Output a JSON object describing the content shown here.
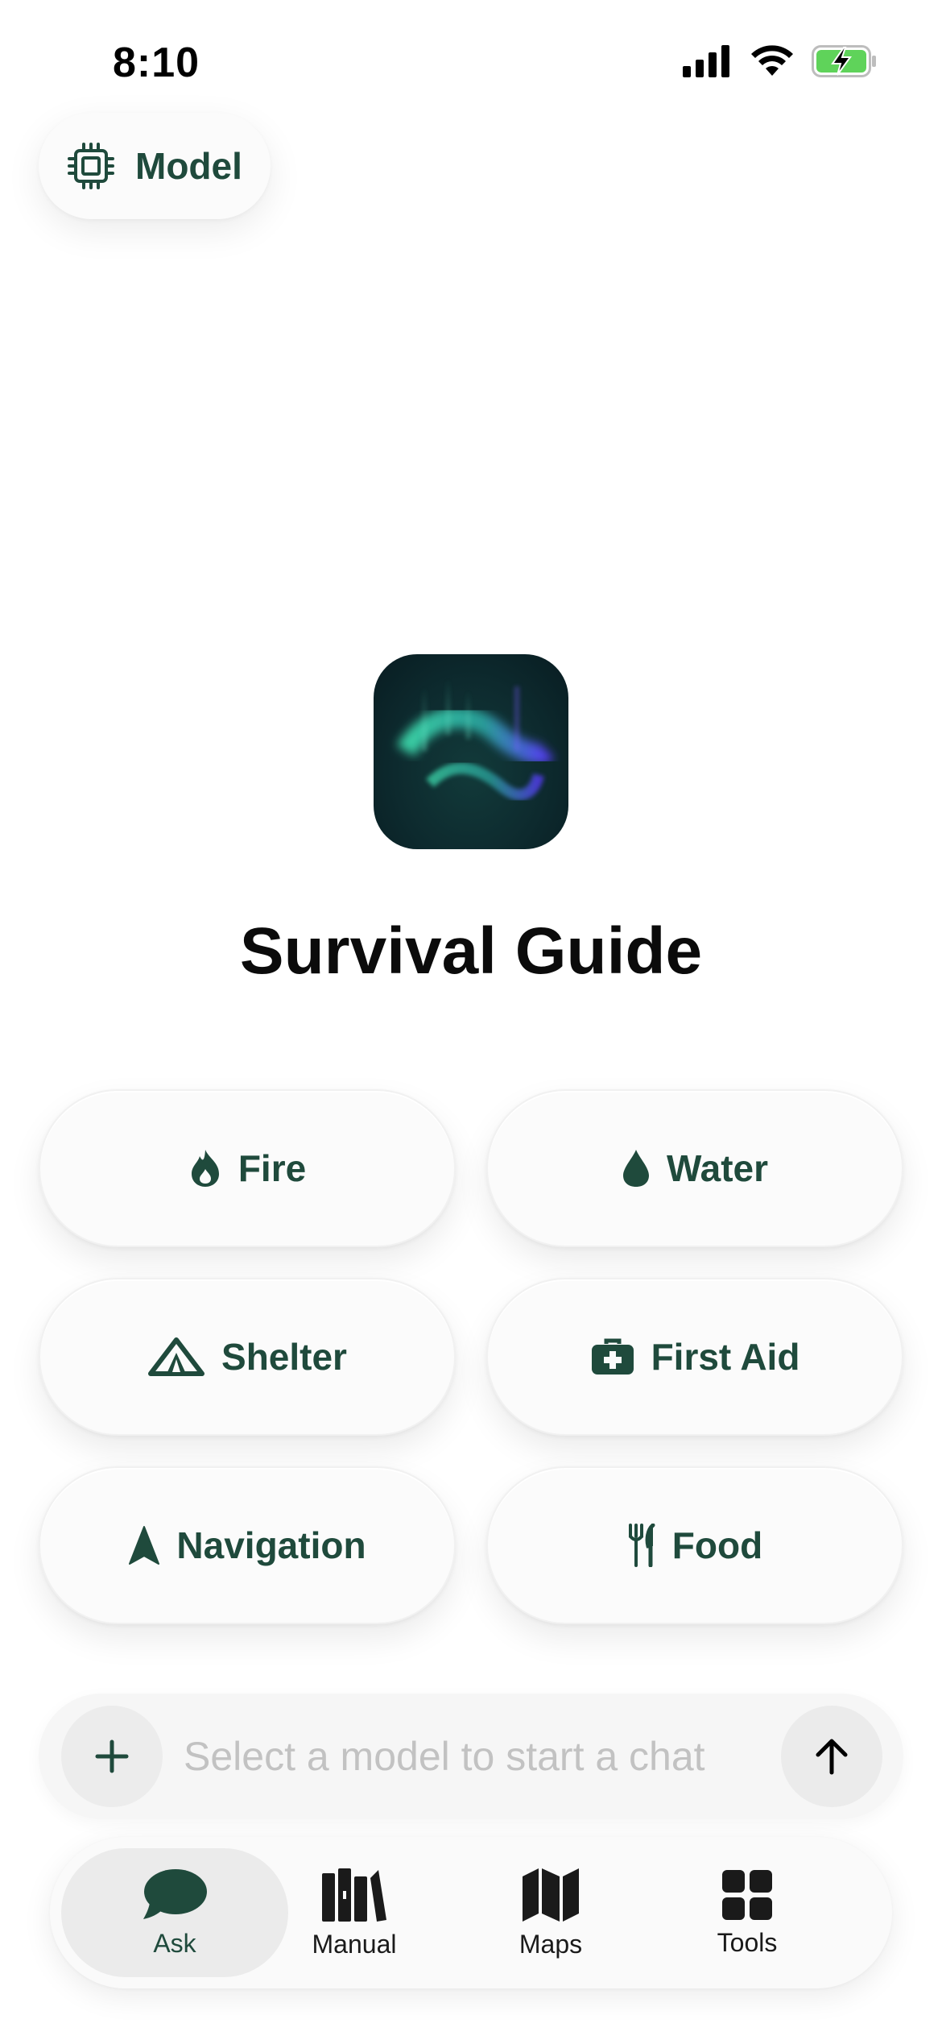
{
  "status_bar": {
    "time": "8:10",
    "icons": [
      "cellular-signal-icon",
      "wifi-icon",
      "battery-charging-icon"
    ]
  },
  "model_button": {
    "label": "Model",
    "icon": "chip-icon"
  },
  "app": {
    "title": "Survival Guide",
    "icon": "aurora-app-icon"
  },
  "categories": [
    {
      "label": "Fire",
      "icon": "flame-icon"
    },
    {
      "label": "Water",
      "icon": "water-drop-icon"
    },
    {
      "label": "Shelter",
      "icon": "tent-icon"
    },
    {
      "label": "First Aid",
      "icon": "medical-kit-icon"
    },
    {
      "label": "Navigation",
      "icon": "navigation-arrow-icon"
    },
    {
      "label": "Food",
      "icon": "fork-knife-icon"
    }
  ],
  "chat": {
    "placeholder": "Select a model to start a chat",
    "value": ""
  },
  "tabs": [
    {
      "label": "Ask",
      "icon": "chat-bubble-icon",
      "active": true
    },
    {
      "label": "Manual",
      "icon": "books-icon",
      "active": false
    },
    {
      "label": "Maps",
      "icon": "map-icon",
      "active": false
    },
    {
      "label": "Tools",
      "icon": "grid-icon",
      "active": false
    }
  ],
  "colors": {
    "accent": "#1f4a3c",
    "background": "#ffffff",
    "button_bg": "#fbfbfb",
    "battery_green": "#5fd35a"
  }
}
